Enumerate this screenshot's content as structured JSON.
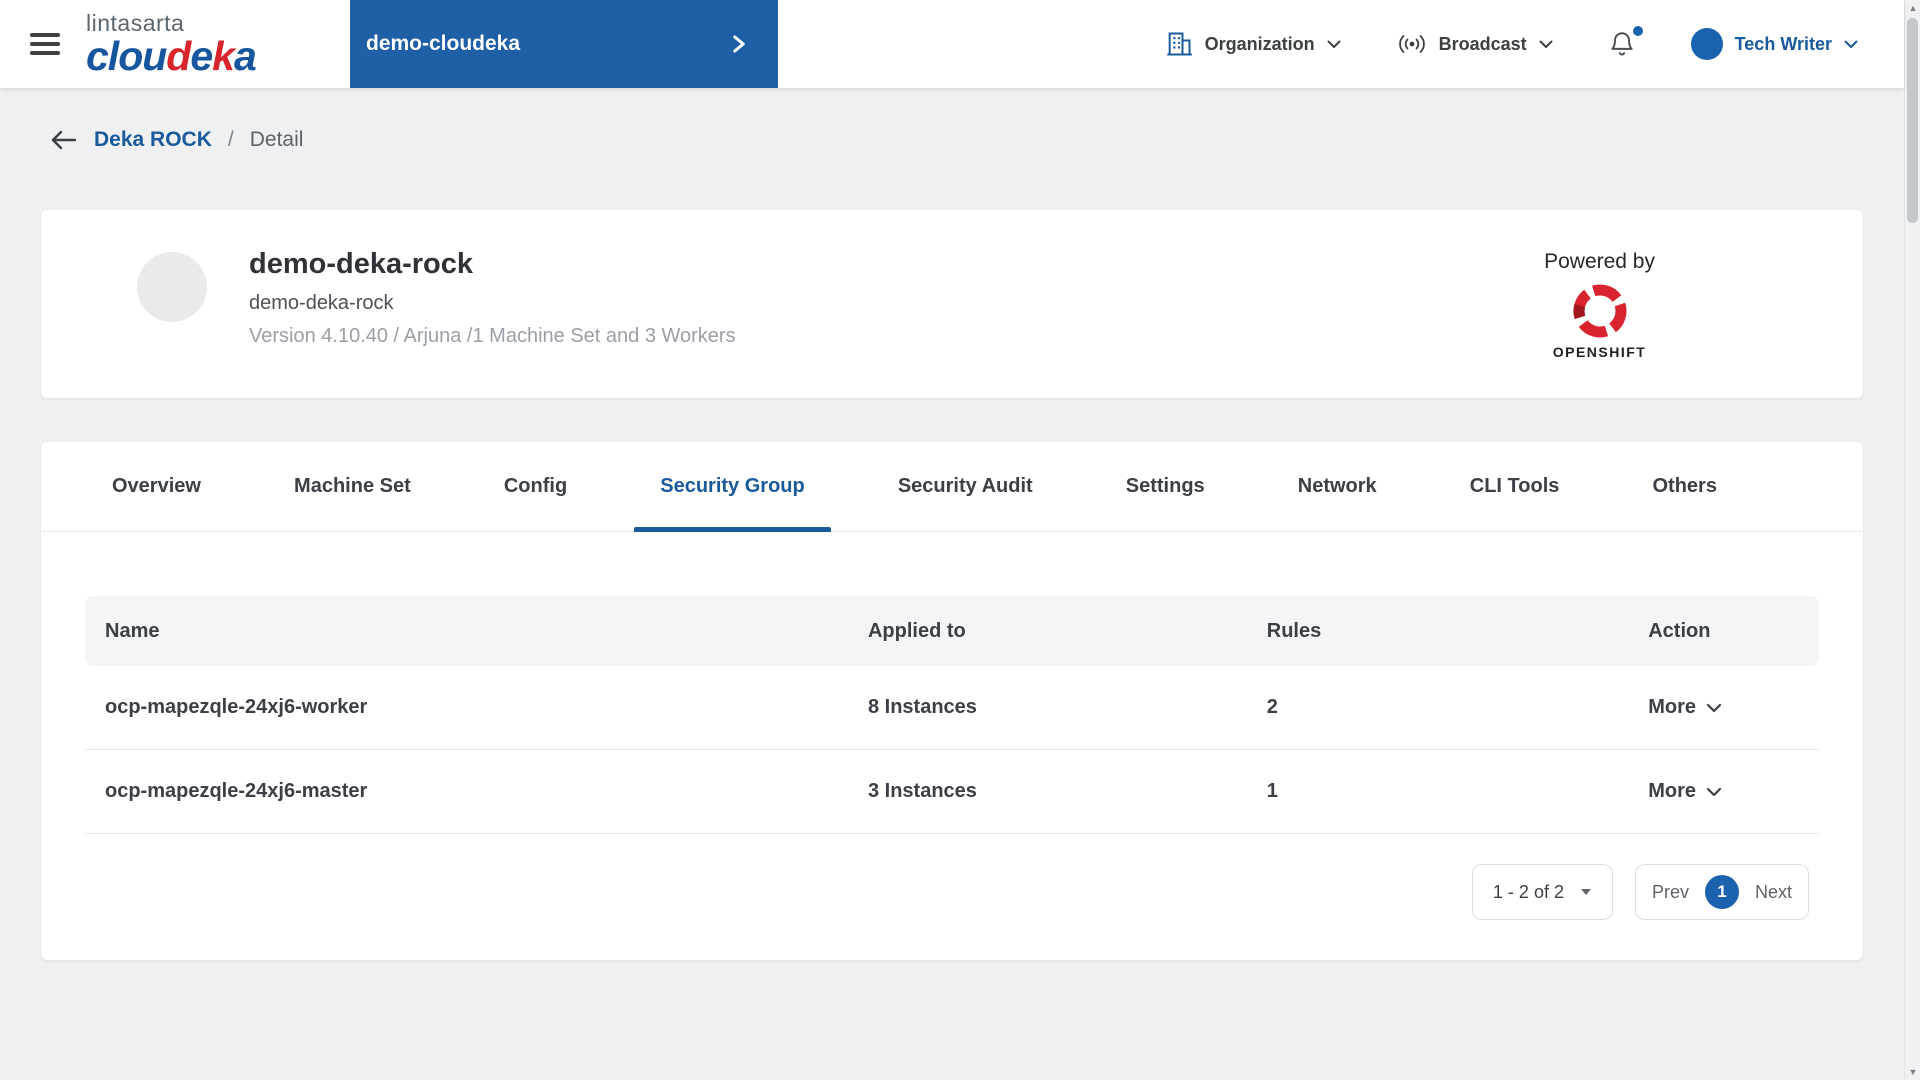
{
  "colors": {
    "primary_blue": "#195a9d",
    "brand_blue": "#15569f",
    "brand_red": "#d9242b",
    "selector_bg": "#1e5fa6",
    "openshift_red": "#d9232e",
    "notification_dot": "#1b62ae"
  },
  "navbar": {
    "brand": {
      "lintasarta": "lintasarta",
      "parts": [
        {
          "text": "clou"
        },
        {
          "text": "d"
        },
        {
          "text": "e"
        },
        {
          "text": "k"
        },
        {
          "text": "a"
        }
      ]
    },
    "project_selector": {
      "label": "demo-cloudeka"
    },
    "menus": {
      "organization": "Organization",
      "broadcast": "Broadcast",
      "user": "Tech Writer"
    }
  },
  "breadcrumb": {
    "parent": "Deka ROCK",
    "separator": "/",
    "current": "Detail"
  },
  "header": {
    "title": "demo-deka-rock",
    "subtitle": "demo-deka-rock",
    "meta": "Version 4.10.40 / Arjuna /1 Machine Set and 3 Workers",
    "powered_by": "Powered by",
    "openshift_wordmark": "OPENSHIFT"
  },
  "tabs": [
    {
      "label": "Overview",
      "active": false
    },
    {
      "label": "Machine Set",
      "active": false
    },
    {
      "label": "Config",
      "active": false
    },
    {
      "label": "Security Group",
      "active": true
    },
    {
      "label": "Security Audit",
      "active": false
    },
    {
      "label": "Settings",
      "active": false
    },
    {
      "label": "Network",
      "active": false
    },
    {
      "label": "CLI Tools",
      "active": false
    },
    {
      "label": "Others",
      "active": false
    }
  ],
  "table": {
    "columns": [
      "Name",
      "Applied to",
      "Rules",
      "Action"
    ],
    "rows": [
      {
        "name": "ocp-mapezqle-24xj6-worker",
        "applied_to": "8 Instances",
        "rules": "2",
        "action": "More"
      },
      {
        "name": "ocp-mapezqle-24xj6-master",
        "applied_to": "3 Instances",
        "rules": "1",
        "action": "More"
      }
    ]
  },
  "pagination": {
    "range_label": "1 - 2 of 2",
    "prev_label": "Prev",
    "current_page": "1",
    "next_label": "Next"
  }
}
